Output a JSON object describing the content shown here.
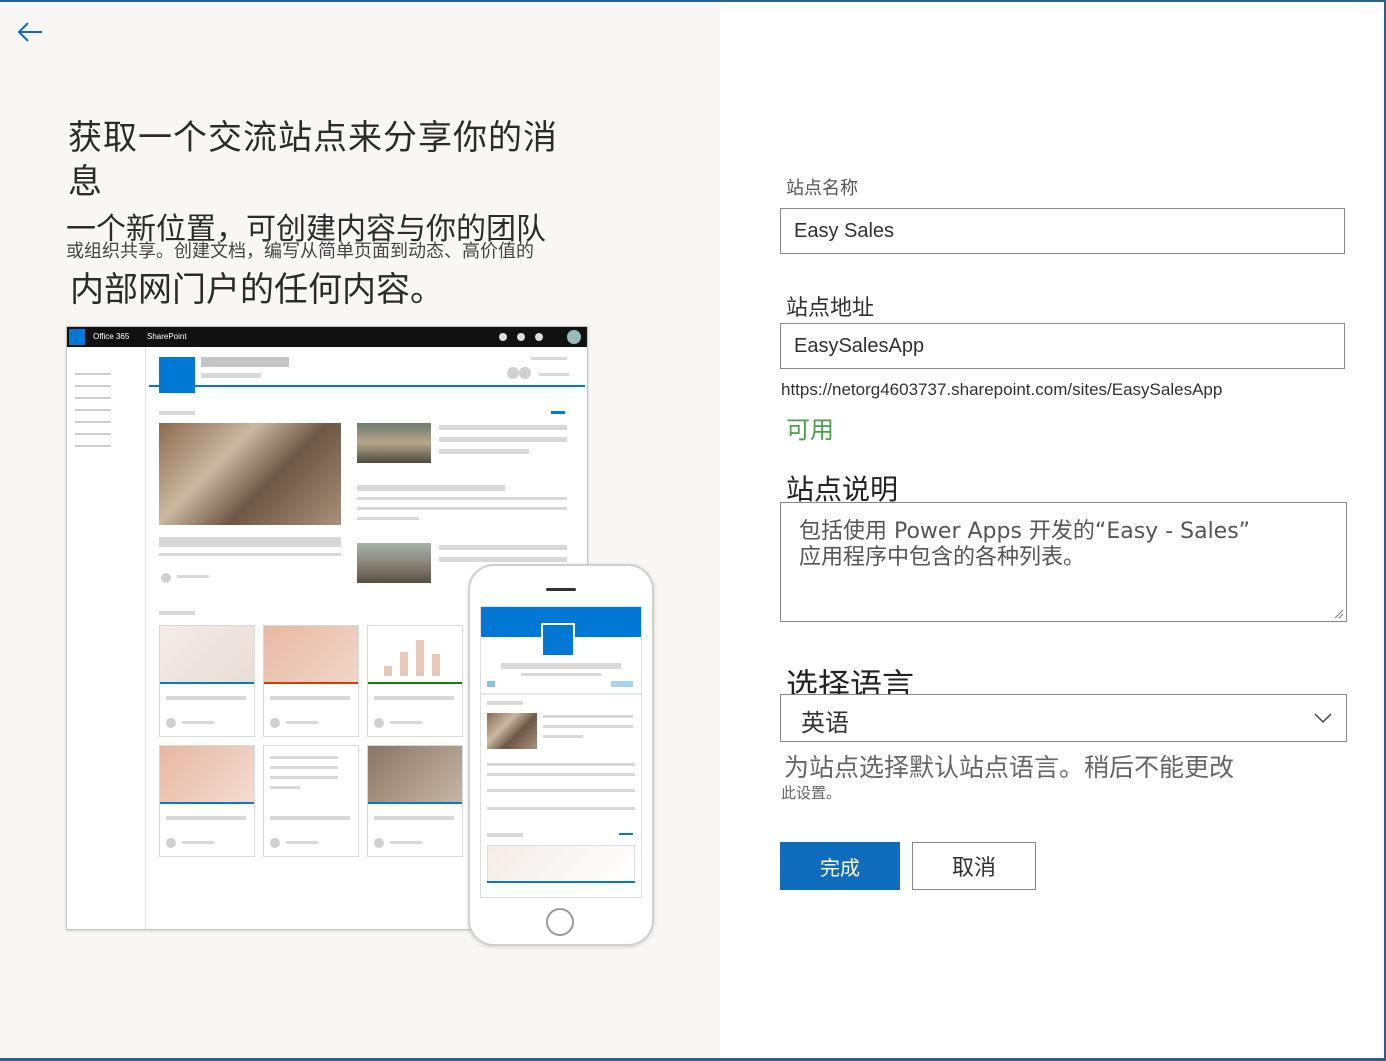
{
  "panel": {
    "headline": "获取一个交流站点来分享你的消息",
    "desc_line1": "一个新位置，可创建内容与你的团队",
    "desc_line2": "或组织共享。创建文档，编写从简单页面到动态、高价值的",
    "desc_line3": "内部网门户的任何内容。"
  },
  "illustration": {
    "suite_app": "Office 365",
    "suite_product": "SharePoint"
  },
  "form": {
    "site_name_label": "站点名称",
    "site_name_value": "Easy Sales",
    "site_address_label": "站点地址",
    "site_address_value": "EasySalesApp",
    "site_url": "https://netorg4603737.sharepoint.com/sites/EasySalesApp",
    "availability": "可用",
    "description_label": "站点说明",
    "description_line1": "包括使用 Power Apps 开发的“Easy -   Sales”",
    "description_line2": "应用程序中包含的各种列表。",
    "language_label": "选择语言",
    "language_value": "英语",
    "language_hint1": "为站点选择默认站点语言。稍后不能更改",
    "language_hint2": "此设置。",
    "finish_label": "完成",
    "cancel_label": "取消"
  },
  "colors": {
    "accent": "#0f6cbd",
    "available": "#4c9e4c",
    "left_panel_bg": "#f8f7f6"
  }
}
